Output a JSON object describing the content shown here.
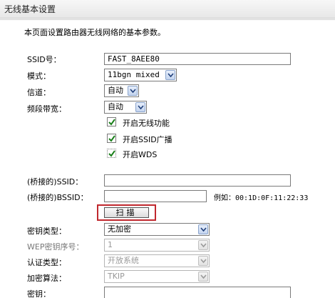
{
  "header": {
    "title": "无线基本设置"
  },
  "description": "本页面设置路由器无线网络的基本参数。",
  "form": {
    "ssid": {
      "label": "SSID号：",
      "value": "FAST_8AEE80"
    },
    "mode": {
      "label": "模式：",
      "value": "11bgn mixed"
    },
    "channel": {
      "label": "信道：",
      "value": "自动"
    },
    "bandwidth": {
      "label": "频段带宽：",
      "value": "自动"
    },
    "checkboxes": [
      {
        "label": "开启无线功能",
        "checked": true
      },
      {
        "label": "开启SSID广播",
        "checked": true
      },
      {
        "label": "开启WDS",
        "checked": true
      }
    ],
    "bridge_ssid": {
      "label": "(桥接的)SSID：",
      "value": ""
    },
    "bridge_bssid": {
      "label": "(桥接的)BSSID：",
      "value": "",
      "example": "例如：00:1D:0F:11:22:33"
    },
    "scan_button": "扫描",
    "key_type": {
      "label": "密钥类型：",
      "value": "无加密"
    },
    "wep_index": {
      "label": "WEP密钥序号：",
      "value": "1"
    },
    "auth_type": {
      "label": "认证类型：",
      "value": "开放系统"
    },
    "encryption": {
      "label": "加密算法：",
      "value": "TKIP"
    },
    "key": {
      "label": "密钥：",
      "value": ""
    }
  },
  "colors": {
    "highlight_border": "#c0282e",
    "check": "#1a7f1a"
  }
}
